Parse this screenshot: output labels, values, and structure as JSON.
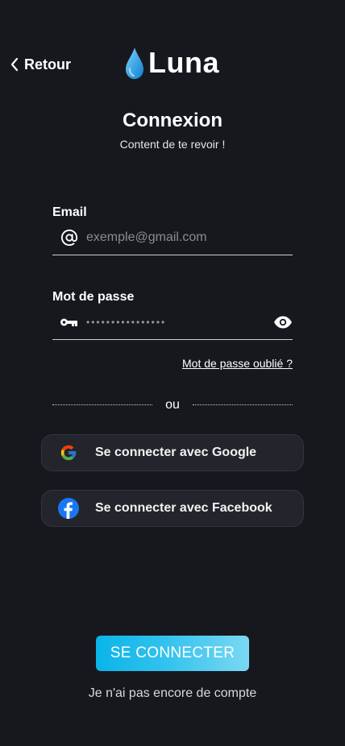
{
  "nav": {
    "back_label": "Retour"
  },
  "brand": {
    "name": "Luna",
    "accent": "#1e9be0"
  },
  "header": {
    "title": "Connexion",
    "subtitle": "Content de te revoir !"
  },
  "form": {
    "email": {
      "label": "Email",
      "placeholder": "exemple@gmail.com",
      "icon": "at-icon"
    },
    "password": {
      "label": "Mot de passe",
      "masked_value": "••••••••••••••••",
      "icon": "key-icon",
      "toggle_icon": "eye-icon"
    },
    "forgot_label": "Mot de passe oublié ?"
  },
  "separator": {
    "label": "ou"
  },
  "social": {
    "google_label": "Se connecter avec Google",
    "facebook_label": "Se connecter avec Facebook"
  },
  "actions": {
    "submit_label": "SE CONNECTER",
    "signup_label": "Je n'ai pas encore de compte"
  },
  "colors": {
    "background": "#17181e",
    "cta_start": "#0ab4e8",
    "cta_end": "#7ad8f2"
  }
}
